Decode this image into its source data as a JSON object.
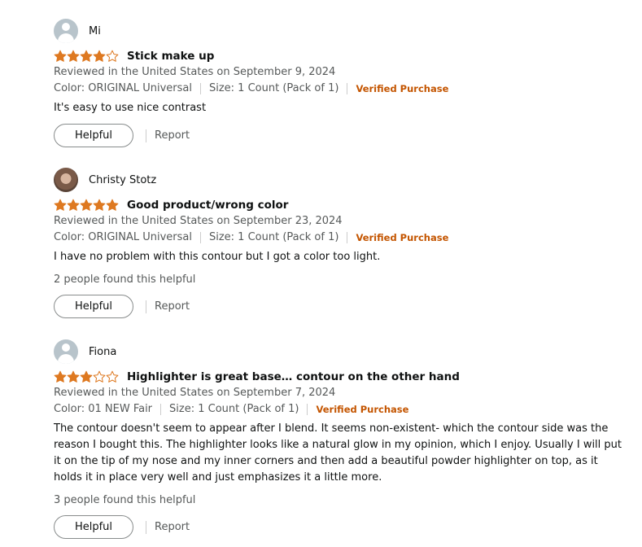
{
  "reviews": [
    {
      "profile_name": "Mi",
      "avatar": "default-avatar",
      "rating": 4,
      "title": "Stick make up",
      "review_date": "Reviewed in the United States on September 9, 2024",
      "color": "Color: ORIGINAL Universal",
      "size": "Size: 1 Count (Pack of 1)",
      "verified": "Verified Purchase",
      "body": "It's easy to use nice contrast",
      "helpful_count": "",
      "helpful_label": "Helpful",
      "report_label": "Report"
    },
    {
      "profile_name": "Christy Stotz",
      "avatar": "photo-avatar",
      "rating": 5,
      "title": "Good product/wrong color",
      "review_date": "Reviewed in the United States on September 23, 2024",
      "color": "Color: ORIGINAL Universal",
      "size": "Size: 1 Count (Pack of 1)",
      "verified": "Verified Purchase",
      "body": "I have no problem with this contour but I got a color too light.",
      "helpful_count": "2 people found this helpful",
      "helpful_label": "Helpful",
      "report_label": "Report"
    },
    {
      "profile_name": "Fiona",
      "avatar": "default-avatar",
      "rating": 3,
      "title": "Highlighter is great base… contour on the other hand",
      "review_date": "Reviewed in the United States on September 7, 2024",
      "color": "Color: 01 NEW Fair",
      "size": "Size: 1 Count (Pack of 1)",
      "verified": "Verified Purchase",
      "body": "The contour doesn't seem to appear after I blend. It seems non-existent- which the contour side was the reason I bought this. The highlighter looks like a natural glow in my opinion, which I enjoy. Usually I will put it on the tip of my nose and my inner corners and then add a beautiful powder highlighter on top, as it holds it in place very well and just emphasizes it a little more.",
      "helpful_count": "3 people found this helpful",
      "helpful_label": "Helpful",
      "report_label": "Report"
    }
  ],
  "colors": {
    "star_filled": "#de7921",
    "star_empty_stroke": "#de7921",
    "verified": "#c45500",
    "muted_text": "#565959"
  },
  "icons": {
    "star_filled": "star-filled-icon",
    "star_empty": "star-empty-icon",
    "avatar": "person-icon"
  }
}
